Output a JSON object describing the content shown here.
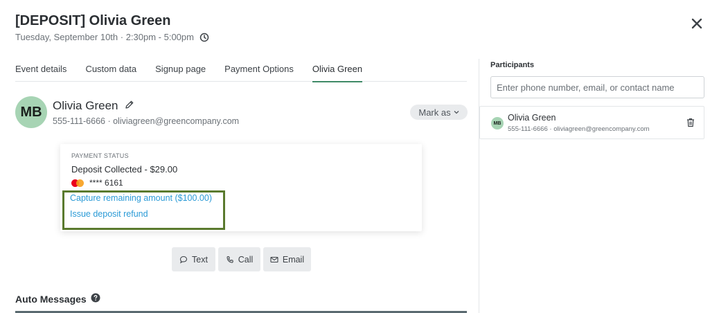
{
  "header": {
    "title": "[DEPOSIT] Olivia Green",
    "subtitle": "Tuesday, September 10th · 2:30pm - 5:00pm",
    "close_icon": "close-icon"
  },
  "tabs": [
    {
      "label": "Event details"
    },
    {
      "label": "Custom data"
    },
    {
      "label": "Signup page"
    },
    {
      "label": "Payment Options"
    },
    {
      "label": "Olivia Green",
      "active": true
    }
  ],
  "contact": {
    "initials": "MB",
    "name": "Olivia Green",
    "details": "555-111-6666 · oliviagreen@greencompany.com",
    "mark_as": "Mark as"
  },
  "payment": {
    "label": "PAYMENT STATUS",
    "status": "Deposit Collected - $29.00",
    "card": "**** 6161",
    "capture_link": "Capture remaining amount ($100.00)",
    "refund_link": "Issue deposit refund"
  },
  "actions": {
    "text": "Text",
    "call": "Call",
    "email": "Email"
  },
  "auto_messages": {
    "title": "Auto Messages"
  },
  "participants": {
    "label": "Participants",
    "placeholder": "Enter phone number, email, or contact name",
    "items": [
      {
        "initials": "MB",
        "name": "Olivia Green",
        "details": "555-111-6666 · oliviagreen@greencompany.com"
      }
    ]
  },
  "colors": {
    "accent": "#3f8a67",
    "link": "#2a9ad6",
    "highlight_box": "#5a7a2e",
    "avatar": "#a7d4b4"
  }
}
